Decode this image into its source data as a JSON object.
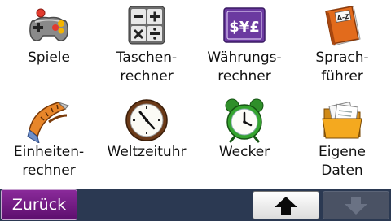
{
  "tiles": [
    {
      "line1": "Spiele",
      "line2": ""
    },
    {
      "line1": "Taschen-",
      "line2": "rechner"
    },
    {
      "line1": "Währungs-",
      "line2": "rechner"
    },
    {
      "line1": "Sprach-",
      "line2": "führer"
    },
    {
      "line1": "Einheiten-",
      "line2": "rechner"
    },
    {
      "line1": "Weltzeituhr",
      "line2": ""
    },
    {
      "line1": "Wecker",
      "line2": ""
    },
    {
      "line1": "Eigene",
      "line2": "Daten"
    }
  ],
  "icons": {
    "currency_text": "$¥£",
    "dictionary_text": "A-Z"
  },
  "bottombar": {
    "back_label": "Zurück"
  },
  "colors": {
    "bar": "#2b3952",
    "back_button": "#7a1f8c"
  }
}
